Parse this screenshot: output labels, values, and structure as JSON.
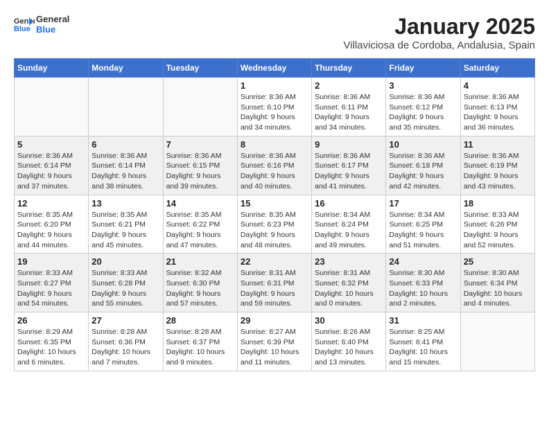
{
  "header": {
    "logo_line1": "General",
    "logo_line2": "Blue",
    "month_title": "January 2025",
    "subtitle": "Villaviciosa de Cordoba, Andalusia, Spain"
  },
  "days_of_week": [
    "Sunday",
    "Monday",
    "Tuesday",
    "Wednesday",
    "Thursday",
    "Friday",
    "Saturday"
  ],
  "weeks": [
    {
      "shaded": false,
      "days": [
        {
          "num": "",
          "info": ""
        },
        {
          "num": "",
          "info": ""
        },
        {
          "num": "",
          "info": ""
        },
        {
          "num": "1",
          "info": "Sunrise: 8:36 AM\nSunset: 6:10 PM\nDaylight: 9 hours and 34 minutes."
        },
        {
          "num": "2",
          "info": "Sunrise: 8:36 AM\nSunset: 6:11 PM\nDaylight: 9 hours and 34 minutes."
        },
        {
          "num": "3",
          "info": "Sunrise: 8:36 AM\nSunset: 6:12 PM\nDaylight: 9 hours and 35 minutes."
        },
        {
          "num": "4",
          "info": "Sunrise: 8:36 AM\nSunset: 6:13 PM\nDaylight: 9 hours and 36 minutes."
        }
      ]
    },
    {
      "shaded": true,
      "days": [
        {
          "num": "5",
          "info": "Sunrise: 8:36 AM\nSunset: 6:14 PM\nDaylight: 9 hours and 37 minutes."
        },
        {
          "num": "6",
          "info": "Sunrise: 8:36 AM\nSunset: 6:14 PM\nDaylight: 9 hours and 38 minutes."
        },
        {
          "num": "7",
          "info": "Sunrise: 8:36 AM\nSunset: 6:15 PM\nDaylight: 9 hours and 39 minutes."
        },
        {
          "num": "8",
          "info": "Sunrise: 8:36 AM\nSunset: 6:16 PM\nDaylight: 9 hours and 40 minutes."
        },
        {
          "num": "9",
          "info": "Sunrise: 8:36 AM\nSunset: 6:17 PM\nDaylight: 9 hours and 41 minutes."
        },
        {
          "num": "10",
          "info": "Sunrise: 8:36 AM\nSunset: 6:18 PM\nDaylight: 9 hours and 42 minutes."
        },
        {
          "num": "11",
          "info": "Sunrise: 8:36 AM\nSunset: 6:19 PM\nDaylight: 9 hours and 43 minutes."
        }
      ]
    },
    {
      "shaded": false,
      "days": [
        {
          "num": "12",
          "info": "Sunrise: 8:35 AM\nSunset: 6:20 PM\nDaylight: 9 hours and 44 minutes."
        },
        {
          "num": "13",
          "info": "Sunrise: 8:35 AM\nSunset: 6:21 PM\nDaylight: 9 hours and 45 minutes."
        },
        {
          "num": "14",
          "info": "Sunrise: 8:35 AM\nSunset: 6:22 PM\nDaylight: 9 hours and 47 minutes."
        },
        {
          "num": "15",
          "info": "Sunrise: 8:35 AM\nSunset: 6:23 PM\nDaylight: 9 hours and 48 minutes."
        },
        {
          "num": "16",
          "info": "Sunrise: 8:34 AM\nSunset: 6:24 PM\nDaylight: 9 hours and 49 minutes."
        },
        {
          "num": "17",
          "info": "Sunrise: 8:34 AM\nSunset: 6:25 PM\nDaylight: 9 hours and 51 minutes."
        },
        {
          "num": "18",
          "info": "Sunrise: 8:33 AM\nSunset: 6:26 PM\nDaylight: 9 hours and 52 minutes."
        }
      ]
    },
    {
      "shaded": true,
      "days": [
        {
          "num": "19",
          "info": "Sunrise: 8:33 AM\nSunset: 6:27 PM\nDaylight: 9 hours and 54 minutes."
        },
        {
          "num": "20",
          "info": "Sunrise: 8:33 AM\nSunset: 6:28 PM\nDaylight: 9 hours and 55 minutes."
        },
        {
          "num": "21",
          "info": "Sunrise: 8:32 AM\nSunset: 6:30 PM\nDaylight: 9 hours and 57 minutes."
        },
        {
          "num": "22",
          "info": "Sunrise: 8:31 AM\nSunset: 6:31 PM\nDaylight: 9 hours and 59 minutes."
        },
        {
          "num": "23",
          "info": "Sunrise: 8:31 AM\nSunset: 6:32 PM\nDaylight: 10 hours and 0 minutes."
        },
        {
          "num": "24",
          "info": "Sunrise: 8:30 AM\nSunset: 6:33 PM\nDaylight: 10 hours and 2 minutes."
        },
        {
          "num": "25",
          "info": "Sunrise: 8:30 AM\nSunset: 6:34 PM\nDaylight: 10 hours and 4 minutes."
        }
      ]
    },
    {
      "shaded": false,
      "days": [
        {
          "num": "26",
          "info": "Sunrise: 8:29 AM\nSunset: 6:35 PM\nDaylight: 10 hours and 6 minutes."
        },
        {
          "num": "27",
          "info": "Sunrise: 8:28 AM\nSunset: 6:36 PM\nDaylight: 10 hours and 7 minutes."
        },
        {
          "num": "28",
          "info": "Sunrise: 8:28 AM\nSunset: 6:37 PM\nDaylight: 10 hours and 9 minutes."
        },
        {
          "num": "29",
          "info": "Sunrise: 8:27 AM\nSunset: 6:39 PM\nDaylight: 10 hours and 11 minutes."
        },
        {
          "num": "30",
          "info": "Sunrise: 8:26 AM\nSunset: 6:40 PM\nDaylight: 10 hours and 13 minutes."
        },
        {
          "num": "31",
          "info": "Sunrise: 8:25 AM\nSunset: 6:41 PM\nDaylight: 10 hours and 15 minutes."
        },
        {
          "num": "",
          "info": ""
        }
      ]
    }
  ]
}
